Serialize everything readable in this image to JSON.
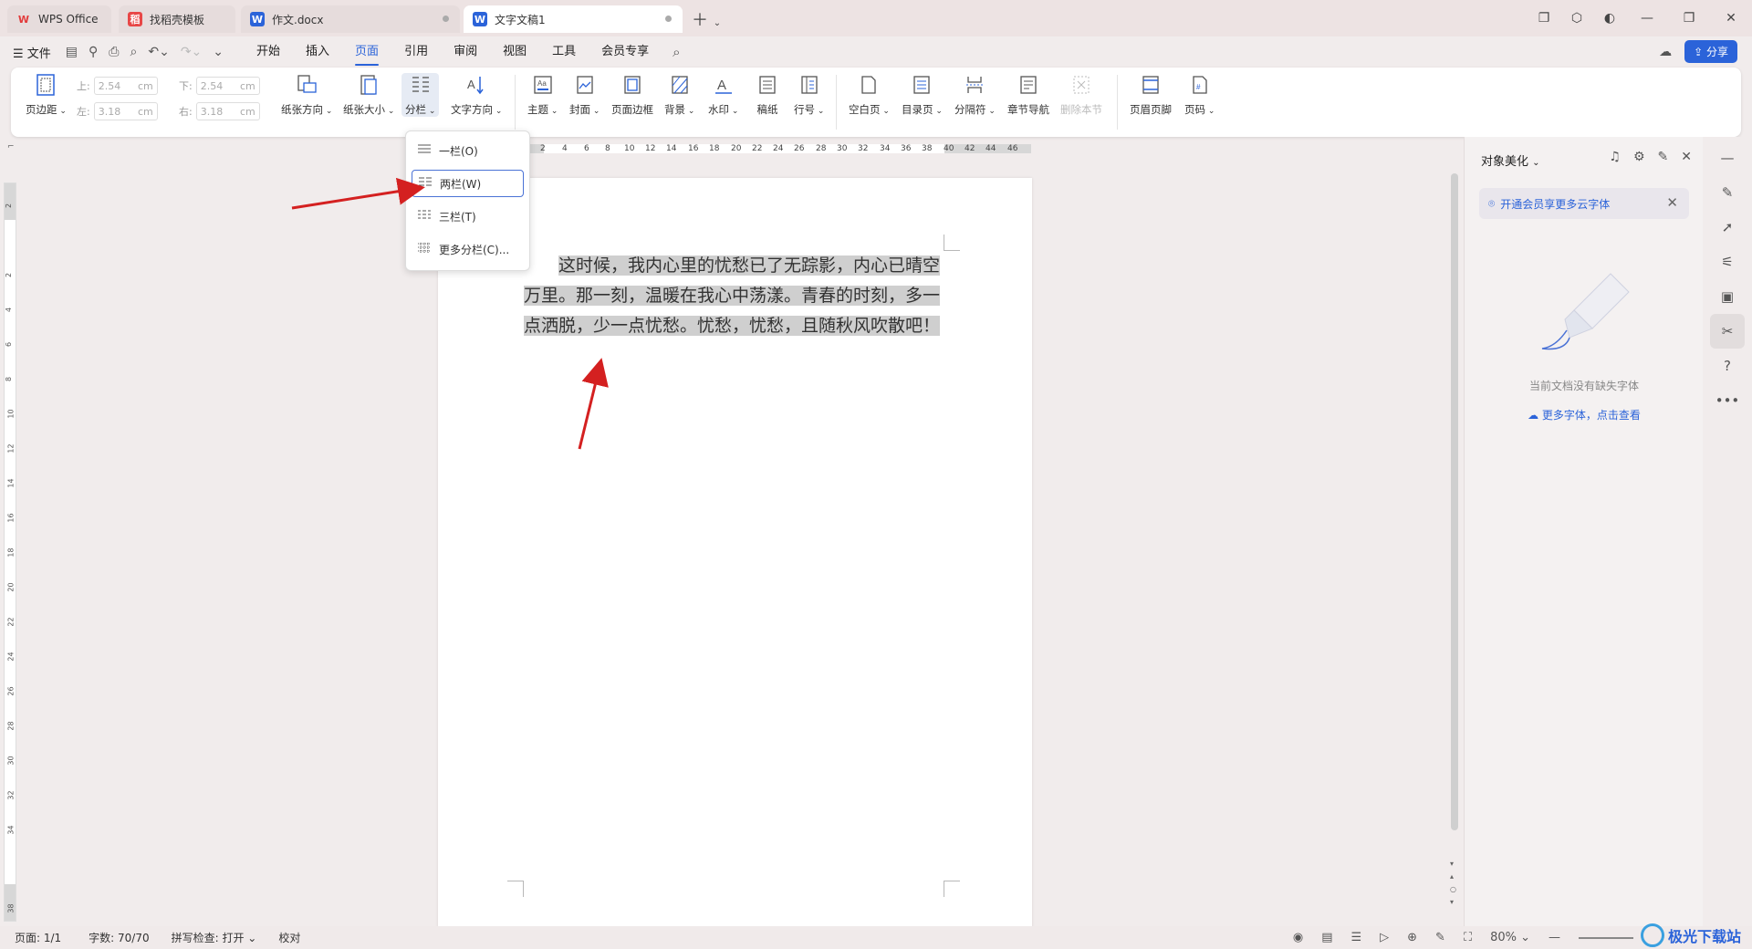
{
  "tabs": [
    {
      "label": "WPS Office",
      "icon": "W"
    },
    {
      "label": "找稻壳模板",
      "icon": "稻"
    },
    {
      "label": "作文.docx",
      "icon": "W"
    },
    {
      "label": "文字文稿1",
      "icon": "W"
    }
  ],
  "menubar": {
    "file": "☰ 文件",
    "tabs": [
      "开始",
      "插入",
      "页面",
      "引用",
      "审阅",
      "视图",
      "工具",
      "会员专享"
    ],
    "active_tab": "页面",
    "share": "分享"
  },
  "ribbon": {
    "margins": {
      "top_label": "上:",
      "top": "2.54",
      "bottom_label": "下:",
      "bottom": "2.54",
      "left_label": "左:",
      "left": "3.18",
      "right_label": "右:",
      "right": "3.18",
      "unit": "cm"
    },
    "buttons": {
      "page_margin": "页边距",
      "orientation": "纸张方向",
      "paper_size": "纸张大小",
      "columns": "分栏",
      "text_direction": "文字方向",
      "theme": "主题",
      "cover": "封面",
      "page_border": "页面边框",
      "background": "背景",
      "watermark": "水印",
      "manuscript": "稿纸",
      "line_number": "行号",
      "blank_page": "空白页",
      "toc_page": "目录页",
      "separator": "分隔符",
      "chapter_nav": "章节导航",
      "delete_section": "删除本节",
      "header_footer": "页眉页脚",
      "page_number": "页码"
    }
  },
  "column_menu": {
    "items": [
      "一栏(O)",
      "两栏(W)",
      "三栏(T)",
      "更多分栏(C)..."
    ],
    "selected": "两栏(W)"
  },
  "document": {
    "text": "这时候，我内心里的忧愁已了无踪影，内心已晴空万里。那一刻，温暖在我心中荡漾。青春的时刻，多一点洒脱，少一点忧愁。忧愁，忧愁，且随秋风吹散吧！"
  },
  "ruler": {
    "horizontal": [
      "2",
      "4",
      "6",
      "8",
      "10",
      "12",
      "14",
      "16",
      "18",
      "20",
      "22",
      "24",
      "26",
      "28",
      "30",
      "32",
      "34",
      "36",
      "38",
      "40",
      "42",
      "44",
      "46"
    ],
    "vertical": [
      "2",
      "2",
      "4",
      "6",
      "8",
      "10",
      "12",
      "14",
      "16",
      "18",
      "20",
      "22",
      "24",
      "26",
      "28",
      "30",
      "32",
      "34",
      "38"
    ]
  },
  "right_panel": {
    "title": "对象美化",
    "vip_notice": "开通会员享更多云字体",
    "empty_text": "当前文档没有缺失字体",
    "more_fonts": "更多字体，点击查看"
  },
  "statusbar": {
    "page": "页面: 1/1",
    "word_count": "字数: 70/70",
    "spell_check": "拼写检查: 打开",
    "proofread": "校对",
    "zoom": "80%"
  },
  "colors": {
    "accent": "#2b63d9",
    "arrow": "#d42020",
    "selection": "#cfcfcf"
  }
}
